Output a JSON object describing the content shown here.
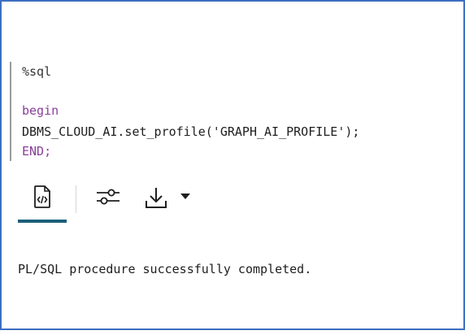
{
  "editor": {
    "lines": {
      "magic": "%sql",
      "begin": "begin",
      "call": "DBMS_CLOUD_AI.set_profile('GRAPH_AI_PROFILE');",
      "end": "END;"
    }
  },
  "toolbar": {
    "icons": {
      "code": "code-file-icon",
      "settings": "sliders-icon",
      "download": "download-icon",
      "dropdown": "caret-down-icon"
    }
  },
  "output": {
    "message": "PL/SQL procedure successfully completed."
  },
  "colors": {
    "border": "#3e6fc1",
    "keyword": "#8a3f9a",
    "active_tab": "#1b5f7a"
  }
}
